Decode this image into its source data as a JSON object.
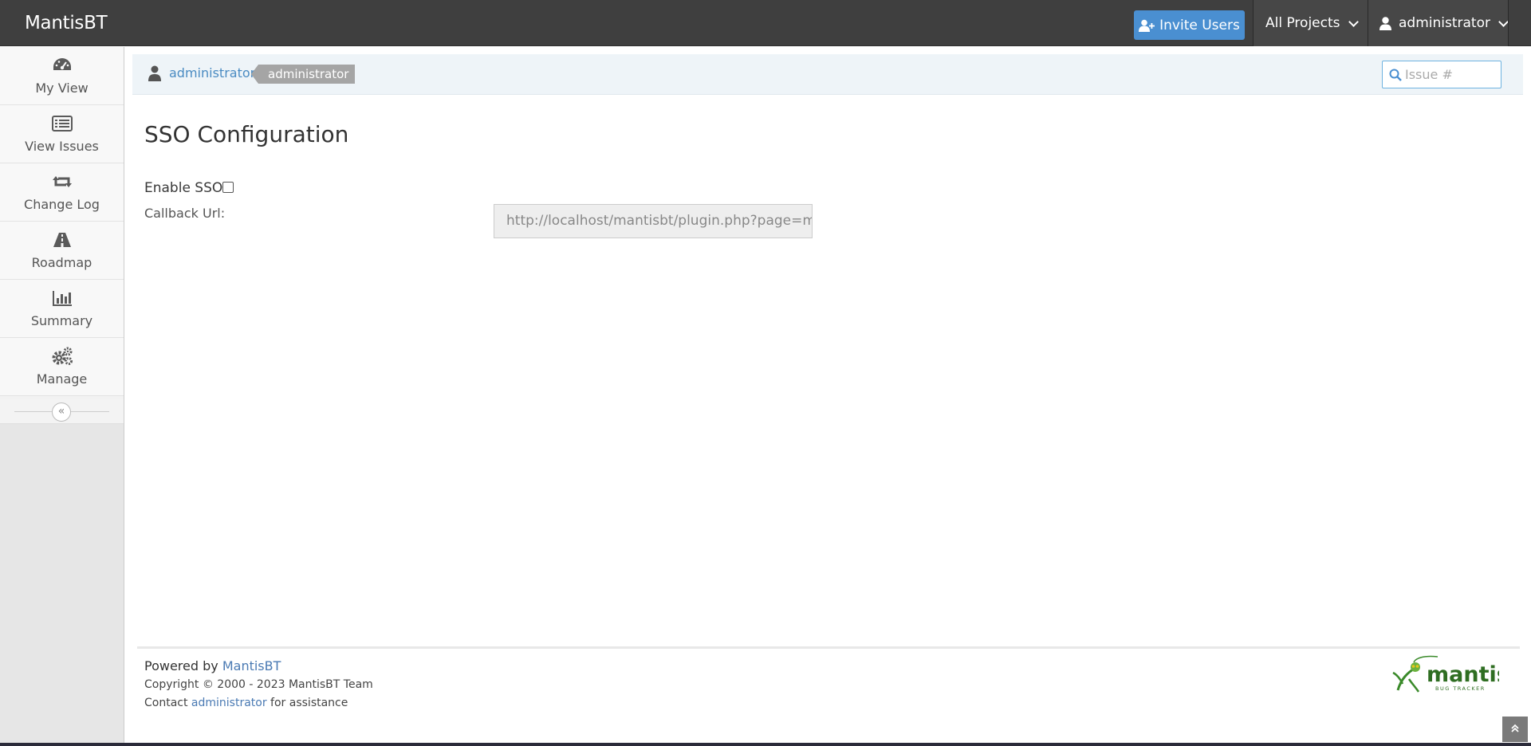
{
  "navbar": {
    "brand": "MantisBT",
    "invite_label": "Invite Users",
    "projects_label": "All Projects",
    "user_label": "administrator"
  },
  "sidebar": {
    "items": [
      {
        "label": "My View",
        "icon": "dashboard-icon"
      },
      {
        "label": "View Issues",
        "icon": "list-icon"
      },
      {
        "label": "Change Log",
        "icon": "retweet-icon"
      },
      {
        "label": "Roadmap",
        "icon": "road-icon"
      },
      {
        "label": "Summary",
        "icon": "bar-chart-icon"
      },
      {
        "label": "Manage",
        "icon": "gears-icon"
      }
    ],
    "collapse_glyph": "«"
  },
  "breadcrumb": {
    "user_link": "administrator",
    "role_badge": "administrator",
    "search_placeholder": "Issue #"
  },
  "main": {
    "title": "SSO Configuration",
    "enable_label": "Enable SSO",
    "enable_checked": false,
    "callback_label": "Callback Url:",
    "callback_value": "http://localhost/mantisbt/plugin.php?page=m"
  },
  "footer": {
    "powered_prefix": "Powered by ",
    "powered_link": "MantisBT",
    "copyright": "Copyright © 2000 - 2023 MantisBT Team",
    "contact_prefix": "Contact ",
    "contact_link": "administrator",
    "contact_suffix": " for assistance",
    "logo_text": "mantis",
    "logo_subtext": "BUG TRACKER"
  },
  "colors": {
    "navbar": "#3f3f3f",
    "accent": "#4a8fd1",
    "link": "#4a8bc2"
  }
}
